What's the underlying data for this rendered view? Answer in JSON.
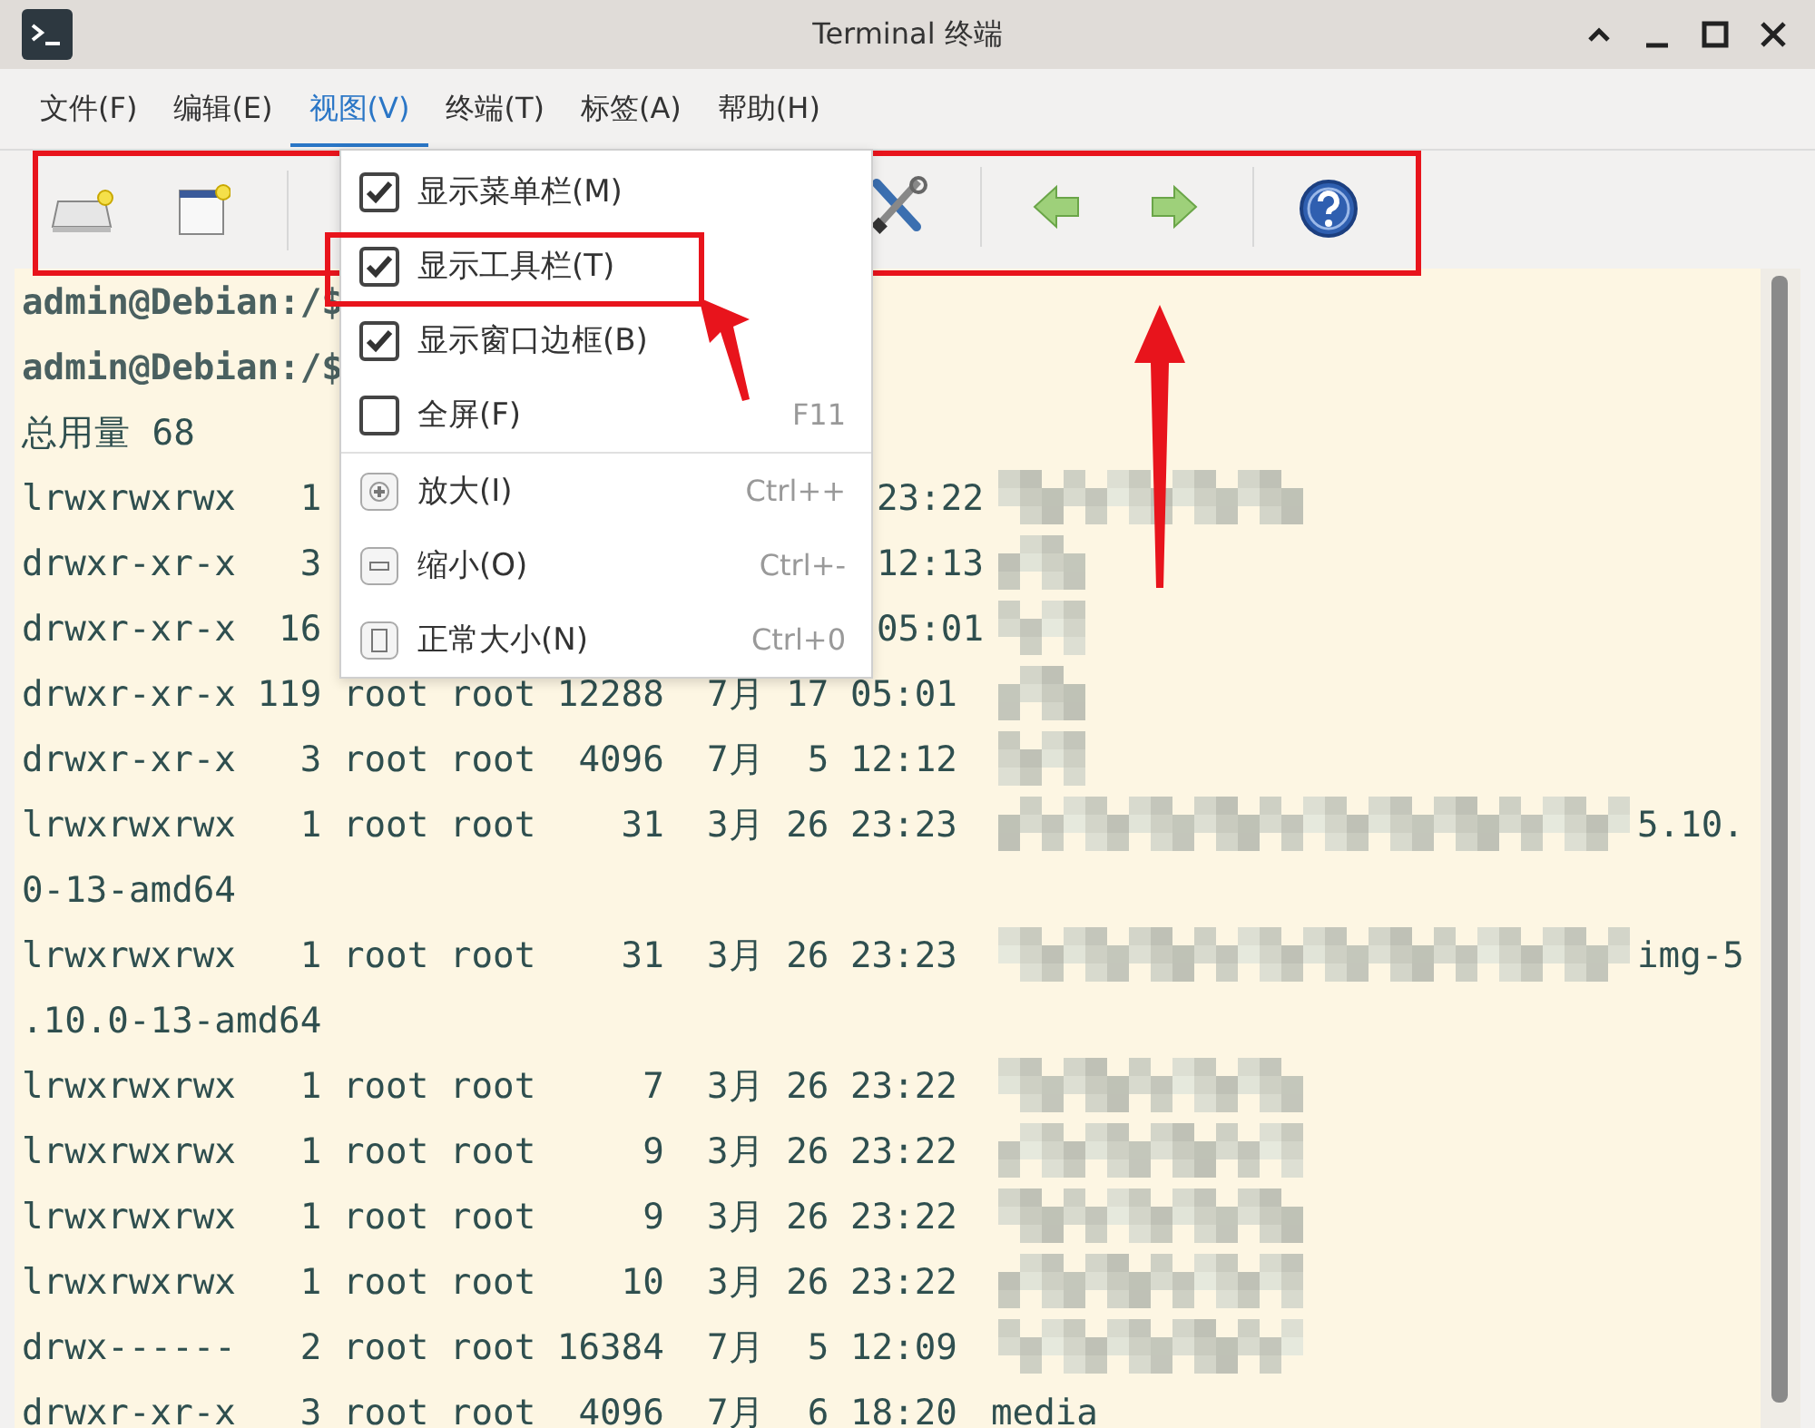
{
  "window": {
    "title": "Terminal 终端"
  },
  "menubar": [
    {
      "label": "文件(F)",
      "selected": false
    },
    {
      "label": "编辑(E)",
      "selected": false
    },
    {
      "label": "视图(V)",
      "selected": true
    },
    {
      "label": "终端(T)",
      "selected": false
    },
    {
      "label": "标签(A)",
      "selected": false
    },
    {
      "label": "帮助(H)",
      "selected": false
    }
  ],
  "view_menu": [
    {
      "kind": "check",
      "label": "显示菜单栏(M)",
      "checked": true
    },
    {
      "kind": "check",
      "label": "显示工具栏(T)",
      "checked": true
    },
    {
      "kind": "check",
      "label": "显示窗口边框(B)",
      "checked": true
    },
    {
      "kind": "check",
      "label": "全屏(F)",
      "checked": false,
      "shortcut": "F11"
    },
    {
      "kind": "separator"
    },
    {
      "kind": "zoom_in",
      "label": "放大(I)",
      "shortcut": "Ctrl++"
    },
    {
      "kind": "zoom_out",
      "label": "缩小(O)",
      "shortcut": "Ctrl+-"
    },
    {
      "kind": "zoom_reset",
      "label": "正常大小(N)",
      "shortcut": "Ctrl+0"
    }
  ],
  "terminal_lines": [
    {
      "text": "admin@Debian:/$"
    },
    {
      "text": "admin@Debian:/$"
    },
    {
      "text": "总用量 68"
    },
    {
      "text": "lrwxrwxrwx   1",
      "tail": "23:22",
      "kind": "redacted_medium"
    },
    {
      "text": "drwxr-xr-x   3",
      "tail": "12:13",
      "kind": "redacted_short"
    },
    {
      "text": "drwxr-xr-x  16",
      "tail": "05:01",
      "kind": "redacted_short"
    },
    {
      "text": "drwxr-xr-x 119 root root 12288  7月 17 05:01",
      "kind": "redacted_short"
    },
    {
      "text": "drwxr-xr-x   3 root root  4096  7月  5 12:12",
      "kind": "redacted_short"
    },
    {
      "text": "lrwxrwxrwx   1 root root    31  3月 26 23:23",
      "kind": "redacted_long",
      "suffix": "5.10."
    },
    {
      "text": "0-13-amd64"
    },
    {
      "text": "lrwxrwxrwx   1 root root    31  3月 26 23:23",
      "kind": "redacted_long",
      "suffix": "img-5"
    },
    {
      "text": ".10.0-13-amd64"
    },
    {
      "text": "lrwxrwxrwx   1 root root     7  3月 26 23:22",
      "kind": "redacted_medium"
    },
    {
      "text": "lrwxrwxrwx   1 root root     9  3月 26 23:22",
      "kind": "redacted_medium"
    },
    {
      "text": "lrwxrwxrwx   1 root root     9  3月 26 23:22",
      "kind": "redacted_medium"
    },
    {
      "text": "lrwxrwxrwx   1 root root    10  3月 26 23:22",
      "kind": "redacted_medium"
    },
    {
      "text": "drwx------   2 root root 16384  7月  5 12:09",
      "kind": "redacted_medium"
    },
    {
      "text": "drwxr-xr-x   3 root root  4096  7月  6 18:20",
      "suffix": "media"
    }
  ]
}
